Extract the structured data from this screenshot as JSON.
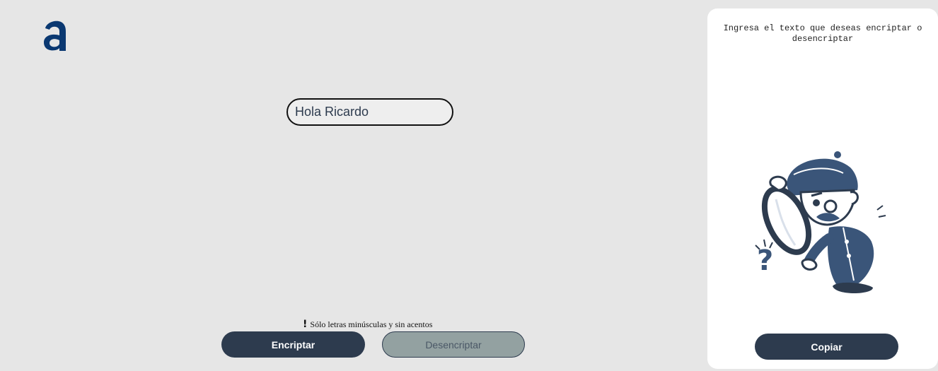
{
  "logo": {
    "icon": "alura-logo-icon",
    "color": "#0a3871"
  },
  "input": {
    "value": "Hola Ricardo"
  },
  "hint": {
    "icon": "exclamation-icon",
    "symbol": "!",
    "text": "Sólo letras minúsculas y sin acentos"
  },
  "buttons": {
    "encrypt_label": "Encriptar",
    "decrypt_label": "Desencriptar"
  },
  "output_panel": {
    "message": "Ingresa el texto que deseas encriptar o desencriptar",
    "illustration": "detective-magnifying-glass-illustration",
    "copy_label": "Copiar"
  },
  "colors": {
    "background": "#e6e6e6",
    "primary": "#2d3b4e",
    "secondary_button": "#93a1a1",
    "panel": "#ffffff"
  }
}
